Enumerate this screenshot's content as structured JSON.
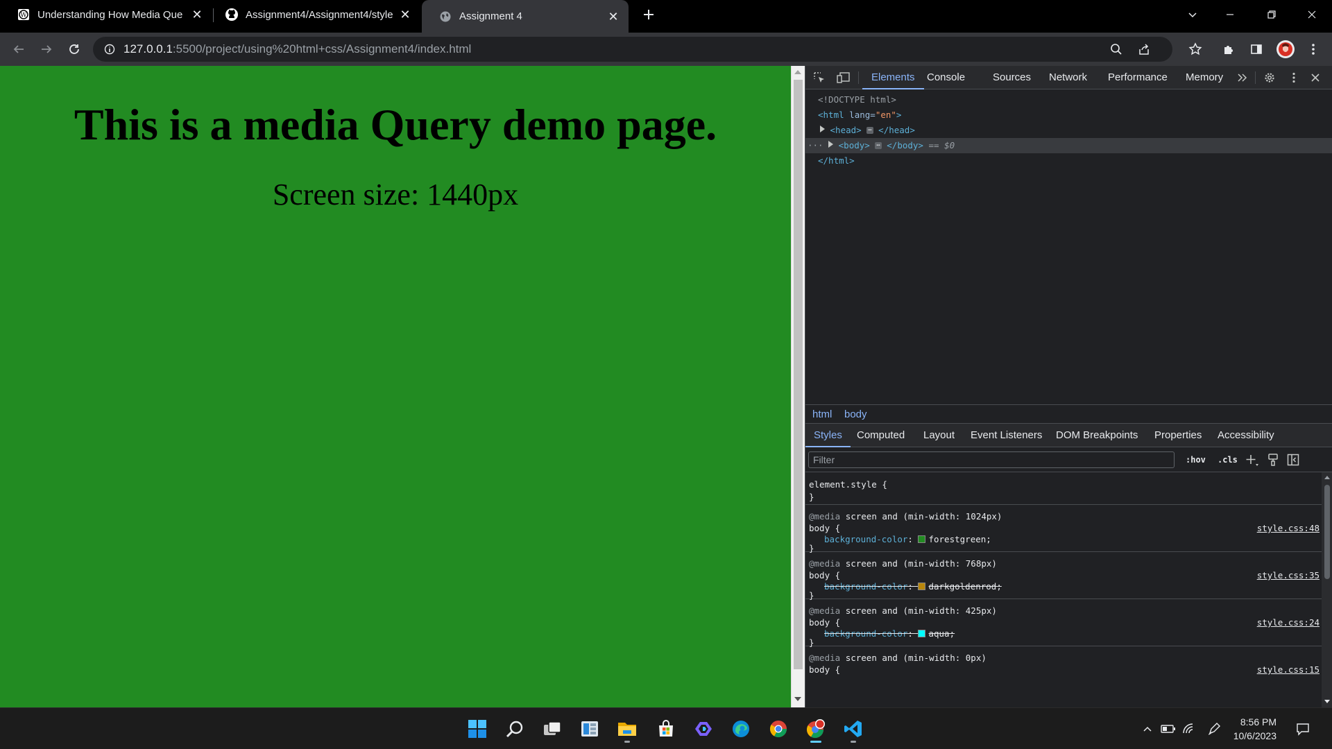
{
  "tabs": [
    {
      "title": "Understanding How Media Que",
      "favicon": "wordpress-icon",
      "active": false
    },
    {
      "title": "Assignment4/Assignment4/style",
      "favicon": "github-icon",
      "active": false
    },
    {
      "title": "Assignment 4",
      "favicon": "globe-icon",
      "active": true
    }
  ],
  "toolbar": {
    "url_host": "127.0.0.1",
    "url_path": ":5500/project/using%20html+css/Assignment4/index.html"
  },
  "page": {
    "heading": "This is a media Query demo page.",
    "text": "Screen size: 1440px",
    "background_color": "#228b22"
  },
  "devtools": {
    "tabs": [
      "Elements",
      "Console",
      "Sources",
      "Network",
      "Performance",
      "Memory"
    ],
    "active_tab": "Elements",
    "dom": {
      "doctype": "<!DOCTYPE html>",
      "html_open_tag": "<html",
      "html_attr_name": "lang",
      "html_attr_value": "\"en\"",
      "html_open_close": ">",
      "head_open": "<head>",
      "head_close": "</head>",
      "body_open": "<body>",
      "body_close": "</body>",
      "body_marker": "== $0",
      "html_close": "</html>",
      "ellipsis": "⋯",
      "gutter_dots": "···"
    },
    "breadcrumb": [
      "html",
      "body"
    ],
    "subtabs": [
      "Styles",
      "Computed",
      "Layout",
      "Event Listeners",
      "DOM Breakpoints",
      "Properties",
      "Accessibility"
    ],
    "active_subtab": "Styles",
    "filter_placeholder": "Filter",
    "hov_label": ":hov",
    "cls_label": ".cls",
    "element_style_open": "element.style {",
    "brace_close": "}",
    "rules": [
      {
        "media_kw": "@media",
        "query": "screen and (min-width: 1024px)",
        "selector": "body {",
        "prop": "background-color",
        "value": "forestgreen;",
        "swatch": "#228b22",
        "struck": false,
        "source": "style.css:48"
      },
      {
        "media_kw": "@media",
        "query": "screen and (min-width: 768px)",
        "selector": "body {",
        "prop": "background-color",
        "value": "darkgoldenrod;",
        "swatch": "#b8860b",
        "struck": true,
        "source": "style.css:35"
      },
      {
        "media_kw": "@media",
        "query": "screen and (min-width: 425px)",
        "selector": "body {",
        "prop": "background-color",
        "value": "aqua;",
        "swatch": "#00ffff",
        "struck": true,
        "source": "style.css:24"
      },
      {
        "media_kw": "@media",
        "query": "screen and (min-width: 0px)",
        "selector": "body {",
        "source": "style.css:15"
      }
    ]
  },
  "taskbar": {
    "time": "8:56 PM",
    "date": "10/6/2023",
    "apps": [
      "start-icon",
      "search-icon",
      "task-view-icon",
      "widgets-icon",
      "file-explorer-icon",
      "microsoft-store-icon",
      "copilot-icon",
      "edge-icon",
      "chrome-icon",
      "chrome-profile-icon",
      "vscode-icon"
    ]
  }
}
